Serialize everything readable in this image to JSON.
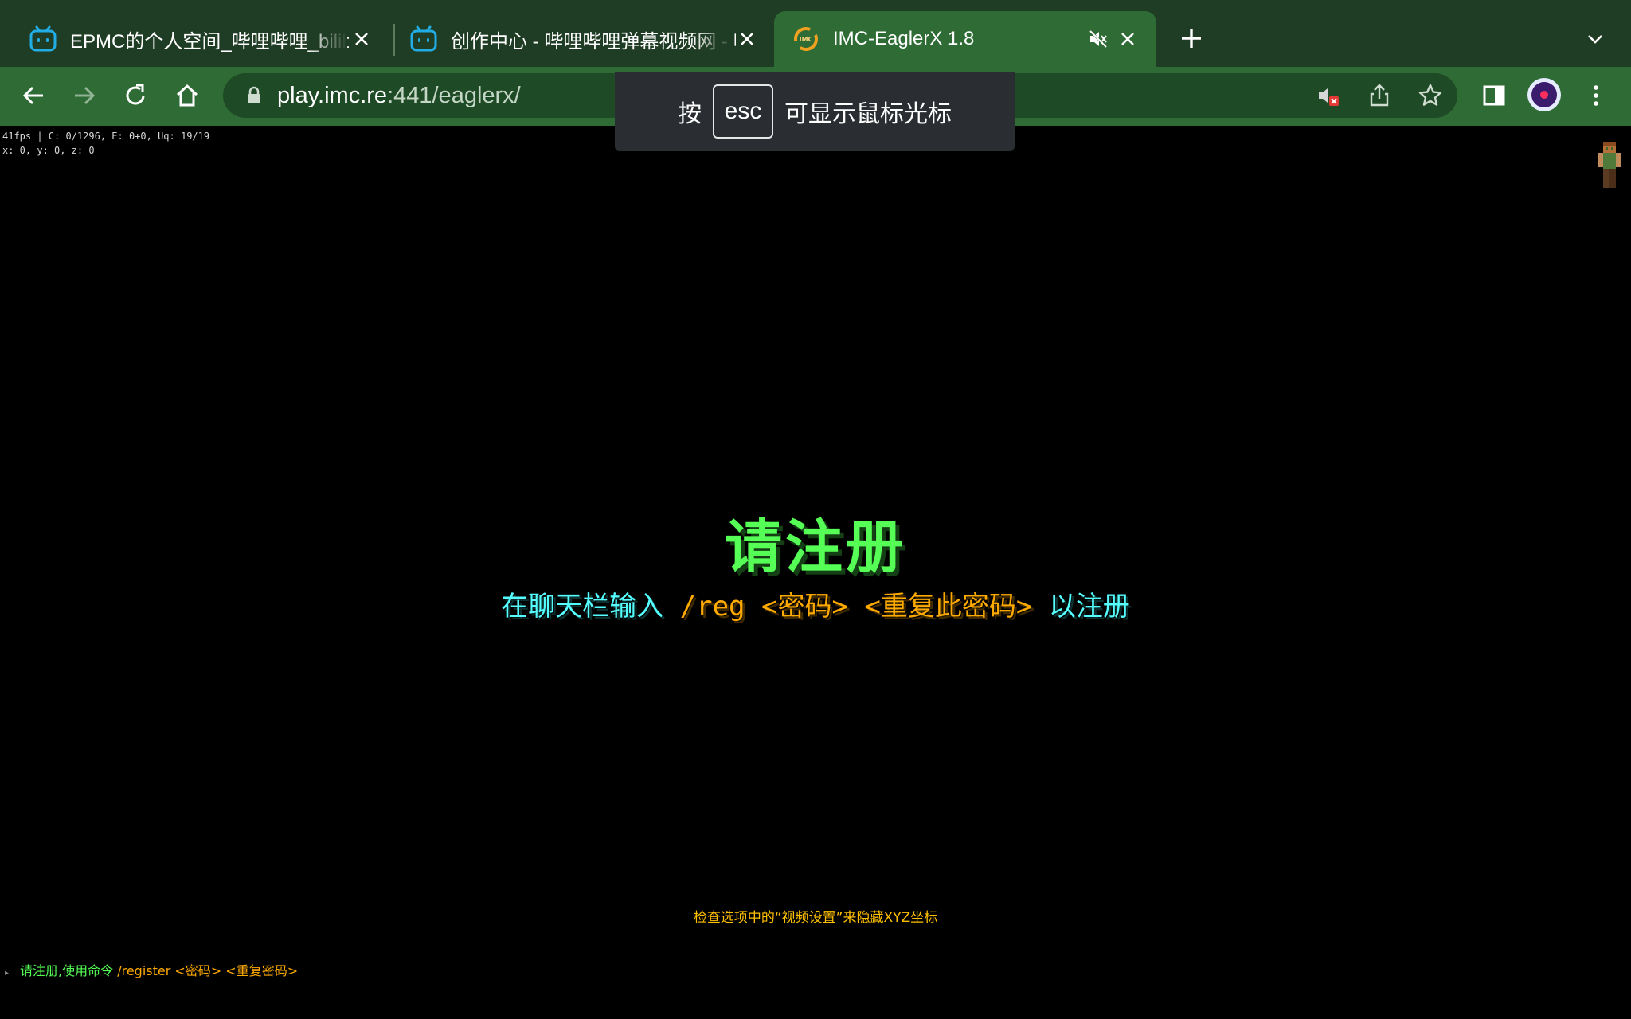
{
  "browser": {
    "tabs": [
      {
        "title": "EPMC的个人空间_哔哩哔哩_bilibili",
        "icon": "bilibili-icon"
      },
      {
        "title": "创作中心 - 哔哩哔哩弹幕视频网 - 哔哩哔哩",
        "icon": "bilibili-icon"
      },
      {
        "title": "IMC-EaglerX 1.8",
        "icon": "imc-favicon",
        "muted": true
      }
    ],
    "url_host": "play.imc.re",
    "url_rest": ":441/eaglerx/"
  },
  "esc_overlay": {
    "prefix": "按",
    "key": "esc",
    "suffix": "可显示鼠标光标"
  },
  "game": {
    "debug_line1": "41fps | C: 0/1296, E: 0+0, Uq: 19/19",
    "debug_line2": "x: 0, y: 0, z: 0",
    "title": "请注册",
    "subtitle_part1": "在聊天栏输入 ",
    "subtitle_part2": "/reg <密码> <重复此密码>",
    "subtitle_part3": " 以注册",
    "hint": "检查选项中的“视频设置”来隐藏XYZ坐标",
    "chat_arrow": "▸",
    "chat_part1": "请注册,使用命令 ",
    "chat_part2": "/register <密码> <重复密码>"
  },
  "colors": {
    "tabstrip": "#1f3c24",
    "toolbar": "#2e6b35",
    "title_green": "#55ff55",
    "aqua": "#55ffff",
    "gold": "#ffaa00"
  }
}
